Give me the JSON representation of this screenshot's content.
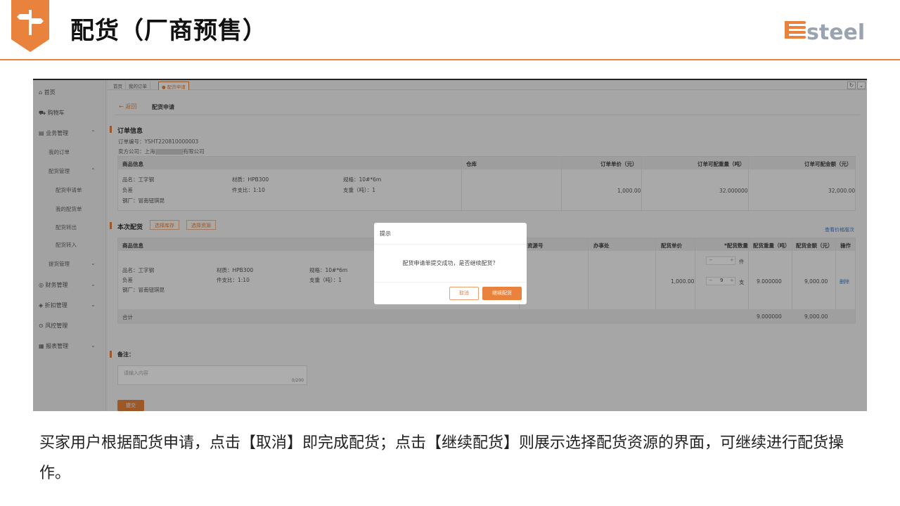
{
  "slide": {
    "title": "配货（厂商预售）",
    "logo_text": "esteel",
    "caption": "买家用户根据配货申请，点击【取消】即完成配货；点击【继续配货】则展示选择配货资源的界面，可继续进行配货操作。",
    "accent_color": "#e8823c"
  },
  "sidebar": {
    "home": "首页",
    "cart": "购物车",
    "business": "业务管理",
    "my_orders": "我的订单",
    "dist_mgmt": "配货管理",
    "dist_apply": "配货申请单",
    "my_dist": "我的配货单",
    "dist_out": "配货转出",
    "dist_in": "配货转入",
    "pickup": "提货管理",
    "finance": "财务管理",
    "discount": "折扣管理",
    "risk": "风控管理",
    "reports": "报表管理"
  },
  "tabs": {
    "t1": "首页",
    "t2": "我的订单",
    "t3": "● 配货申请"
  },
  "page": {
    "back": "← 返回",
    "crumb": "配货申请",
    "order_section": "订单信息",
    "order_no": "订单编号：YSHT220810000003",
    "seller_prefix": "卖方公司：上海",
    "seller_suffix": "有限公司",
    "dist_section": "本次配货",
    "select_stock": "选择库存",
    "select_resource": "选择资源",
    "price_history": "查看价格版次",
    "remark_label": "备注：",
    "remark_placeholder": "请输入内容",
    "remark_count": "0/200",
    "submit": "提交"
  },
  "order_table": {
    "headers": [
      "商品信息",
      "仓库",
      "订单单价（元）",
      "订单可配重量（吨）",
      "订单可配金额（元）"
    ],
    "product": "品名：工字钢",
    "material": "材质：HPB300",
    "spec": "规格：10#*6m",
    "grade": "负差",
    "ratio": "件支比：1:10",
    "weight_ratio": "支重（吨）：1",
    "mill": "钢厂：冒南钮琪昆",
    "unit_price": "1,000.00",
    "avail_weight": "32.000000",
    "avail_amount": "32,000.00"
  },
  "dist_table": {
    "headers": [
      "商品信息",
      "资源号",
      "办事处",
      "配货单价",
      "*配货数量",
      "配货重量（吨）",
      "配货金额（元）",
      "操作"
    ],
    "product": "品名：工字钢",
    "material": "材质：HPB300",
    "spec": "规格：10#*6m",
    "grade": "负差",
    "ratio": "件支比：1:10",
    "weight_ratio": "支重（吨）：1",
    "mill": "钢厂：冒南钮琪昆",
    "unit_price": "1,000.00",
    "qty_pieces_unit": "件",
    "qty_bars": "9",
    "qty_bars_unit": "支",
    "weight": "9.000000",
    "amount": "9,000.00",
    "delete": "删除",
    "total_label": "合计",
    "total_weight": "9.000000",
    "total_amount": "9,000.00"
  },
  "dialog": {
    "title": "提示",
    "message": "配货申请单提交成功，是否继续配货？",
    "cancel": "取消",
    "confirm": "继续配货"
  }
}
